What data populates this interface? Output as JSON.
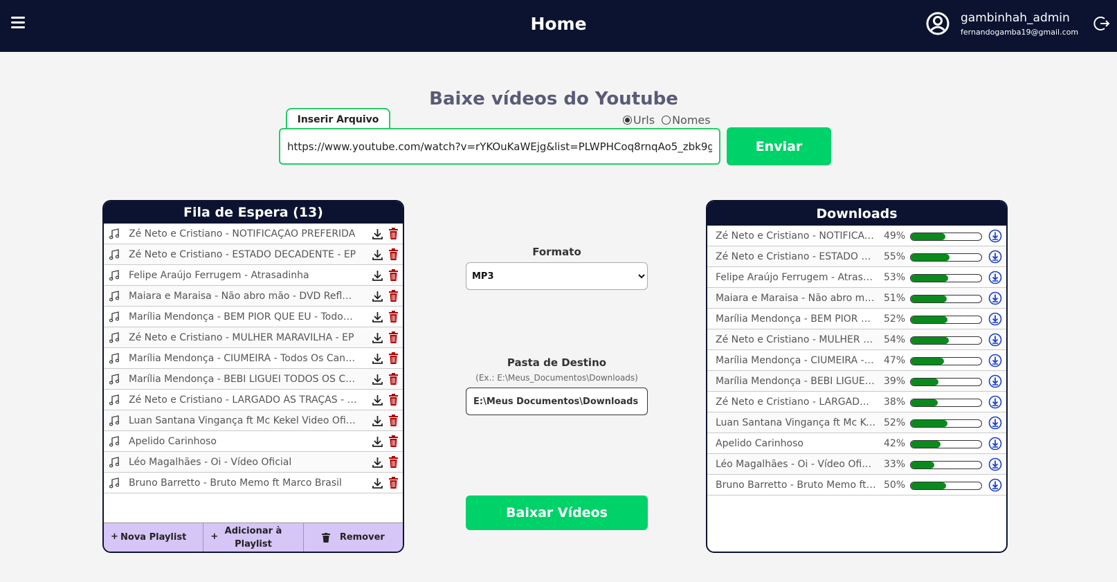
{
  "header": {
    "title": "Home",
    "user_name": "gambinhah_admin",
    "user_email": "fernandogamba19@gmail.com"
  },
  "hero": {
    "title": "Baixe vídeos do Youtube",
    "file_tab": "Inserir Arquivo",
    "radio_urls": "Urls",
    "radio_names": "Nomes",
    "selected_mode": "Urls",
    "url_value": "https://www.youtube.com/watch?v=rYKOuKaWEjg&list=PLWPHCoq8rnqAo5_zbk9g",
    "send_label": "Enviar"
  },
  "queue": {
    "title": "Fila de Espera (13)",
    "items": [
      "Zé Neto e Cristiano - NOTIFICAÇÃO PREFERIDA",
      "Zé Neto e Cristiano - ESTADO DECADENTE - EP",
      "Felipe Araújo  Ferrugem - Atrasadinha",
      "Maiara e Maraisa - Não abro mão - DVD Reflexo",
      "Marília Mendonça - BEM PIOR QUE EU - Todos Os Cantos",
      "Zé Neto e Cristiano - MULHER MARAVILHA - EP",
      "Marília Mendonça - CIUMEIRA - Todos Os Cantos",
      "Marília Mendonça - BEBI LIGUEI TODOS OS CANTOS",
      "Zé Neto e Cristiano - LARGADO ÀS TRAÇAS - EP",
      "Luan Santana  Vingança ft Mc Kekel Video Oficial",
      "Apelido Carinhoso",
      "Léo Magalhães - Oi - Vídeo Oficial",
      "Bruno  Barretto - Bruto Memo ft Marco Brasil"
    ],
    "footer": {
      "new_playlist": "Nova Playlist",
      "add_playlist": "Adicionar à Playlist",
      "remove": "Remover",
      "plus": "+"
    }
  },
  "middle": {
    "format_label": "Formato",
    "format_value": "MP3",
    "dest_label": "Pasta de Destino",
    "dest_hint": "(Ex.: E:\\Meus_Documentos\\Downloads)",
    "dest_value": "E:\\Meus Documentos\\Downloads",
    "download_label": "Baixar Vídeos"
  },
  "downloads": {
    "title": "Downloads",
    "items": [
      {
        "title": "Zé Neto e Cristiano - NOTIFICAÇÃO PREFERIDA",
        "percent": "49%",
        "progress": 0.49
      },
      {
        "title": "Zé Neto e Cristiano - ESTADO DECADENTE",
        "percent": "55%",
        "progress": 0.55
      },
      {
        "title": "Felipe Araújo Ferrugem - Atrasadinha",
        "percent": "53%",
        "progress": 0.53
      },
      {
        "title": "Maiara e Maraisa - Não abro mão - DVD",
        "percent": "51%",
        "progress": 0.51
      },
      {
        "title": "Marília Mendonça - BEM PIOR QUE EU",
        "percent": "52%",
        "progress": 0.52
      },
      {
        "title": "Zé Neto e Cristiano - MULHER MARAVILHA",
        "percent": "54%",
        "progress": 0.54
      },
      {
        "title": "Marília Mendonça - CIUMEIRA - Todos",
        "percent": "47%",
        "progress": 0.47
      },
      {
        "title": "Marília Mendonça - BEBI LIGUEI TODOS",
        "percent": "39%",
        "progress": 0.39
      },
      {
        "title": "Zé Neto e Cristiano - LARGADO ÀS TRAÇAS",
        "percent": "38%",
        "progress": 0.38
      },
      {
        "title": "Luan Santana Vingança ft Mc Kekel",
        "percent": "52%",
        "progress": 0.52
      },
      {
        "title": "Apelido Carinhoso",
        "percent": "42%",
        "progress": 0.42
      },
      {
        "title": "Léo Magalhães - Oi - Vídeo Oficial",
        "percent": "33%",
        "progress": 0.33
      },
      {
        "title": "Bruno Barretto - Bruto Memo ft Marco",
        "percent": "50%",
        "progress": 0.5
      }
    ]
  },
  "colors": {
    "header_bg": "#0b1330",
    "accent_green": "#00d26a",
    "progress_green": "#0a8a1c",
    "trash_red": "#b00000",
    "download_blue": "#1a3fcf",
    "footer_purple": "#d6c6f7"
  }
}
